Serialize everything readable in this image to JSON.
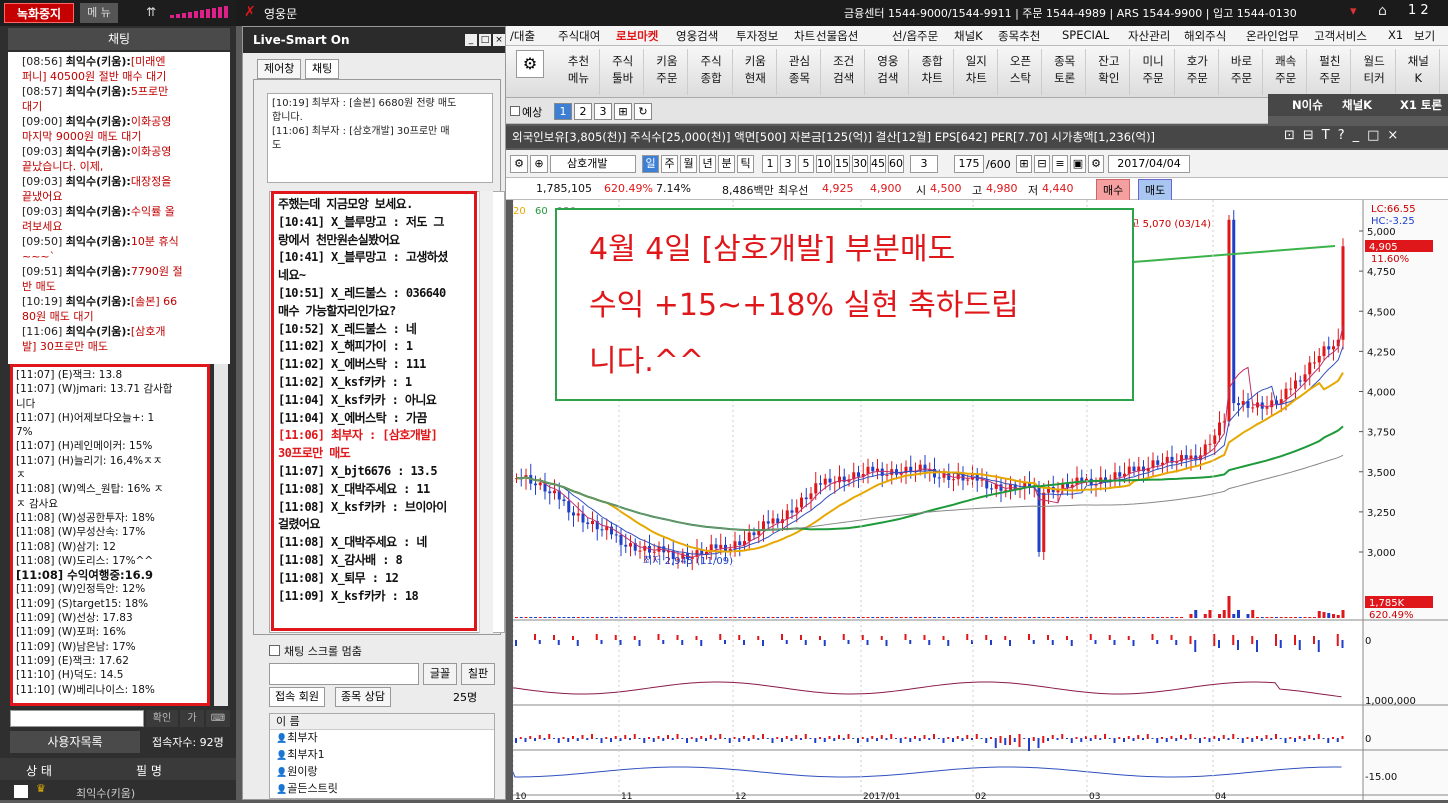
{
  "left": {
    "record_label": "녹화중지",
    "menu_label": "메 뉴",
    "signal_icon": "antenna-icon",
    "chat_title": "채팅",
    "chat1": [
      {
        "t": "[08:56] ",
        "n": "최익수(키움):",
        "m": "[미래엔"
      },
      {
        "t": "",
        "n": "",
        "m": "퍼니] 40500원 절반 매수 대기"
      },
      {
        "t": "[08:57] ",
        "n": "최익수(키움):",
        "m": "5프로만"
      },
      {
        "t": "",
        "n": "",
        "m": "대기"
      },
      {
        "t": "[09:00] ",
        "n": "최익수(키움):",
        "m": "이화공영"
      },
      {
        "t": "",
        "n": "",
        "m": "마지막 9000원 매도 대기"
      },
      {
        "t": "[09:03] ",
        "n": "최익수(키움):",
        "m": "이화공영"
      },
      {
        "t": "",
        "n": "",
        "m": "끝났습니다. 이제,"
      },
      {
        "t": "[09:03] ",
        "n": "최익수(키움):",
        "m": "대장정을"
      },
      {
        "t": "",
        "n": "",
        "m": "끝냈어요"
      },
      {
        "t": "[09:03] ",
        "n": "최익수(키움):",
        "m": "수익률 올"
      },
      {
        "t": "",
        "n": "",
        "m": "려보세요"
      },
      {
        "t": "[09:50] ",
        "n": "최익수(키움):",
        "m": "10분 휴식"
      },
      {
        "t": "",
        "n": "",
        "m": "~~~`"
      },
      {
        "t": "[09:51] ",
        "n": "최익수(키움):",
        "m": "7790원 절"
      },
      {
        "t": "",
        "n": "",
        "m": "반 매도"
      },
      {
        "t": "[10:19] ",
        "n": "최익수(키움):",
        "m": "[솔본] 66"
      },
      {
        "t": "",
        "n": "",
        "m": "80원 매도 대기"
      },
      {
        "t": "[11:06] ",
        "n": "최익수(키움):",
        "m": "[삼호개"
      },
      {
        "t": "",
        "n": "",
        "m": "발] 30프로만 매도"
      }
    ],
    "chat2": [
      "[11:07] (E)잭크: 13.8",
      "[11:07] (W)jmari: 13.71 감사합",
      "니다",
      "[11:07] (H)어제보다오늘+: 1",
      "7%",
      "[11:07] (H)레인메이커: 15%",
      "[11:07] (H)늘리기: 16,4%ㅈㅈ",
      "ㅈ",
      "[11:08] (W)엑스_원탑: 16% ㅈ",
      "ㅈ 감사요",
      "[11:08] (W)성공한투자: 18%",
      "[11:08] (W)무성산속: 17%",
      "[11:08] (W)삼기: 12",
      "[11:08] (W)도리스: 17%^^",
      "[11:08] 수익여행중:16.9",
      "[11:09] (W)인정득안: 12%",
      "[11:09] (S)target15: 18%",
      "[11:09] (W)선상: 17.83",
      "[11:09] (W)포퍼: 16%",
      "[11:09] (W)남은남: 17%",
      "[11:09] (E)잭크: 17.62",
      "[11:10] (H)덕도: 14.5",
      "[11:10] (W)베리나이스: 18%"
    ],
    "confirm_label": "확인",
    "userlist_label": "사용자목록",
    "connections": "접속자수: 92명",
    "col_status": "상 태",
    "col_name": "필 명",
    "last_user": "최익수(키움)"
  },
  "ls": {
    "title": "Live-Smart On",
    "tab_notice": "제어창",
    "tab_chat": "채팅",
    "notice": [
      "[10:19] 최부자 : [솔본] 6680원 전량 매도",
      "합니다.",
      "[11:06] 최부자 : [삼호개발] 30프로만 매",
      "도"
    ],
    "chat": [
      {
        "c": "",
        "m": "주했는데 지금모앙 보세요."
      },
      {
        "c": "",
        "m": "[10:41] X_블루망고 : 저도 그"
      },
      {
        "c": "",
        "m": "랑에서 천만원손실봤어요"
      },
      {
        "c": "",
        "m": "[10:41] X_블루망고 : 고생하셨"
      },
      {
        "c": "",
        "m": "네요~"
      },
      {
        "c": "",
        "m": "[10:51] X_레드불스 : 036640"
      },
      {
        "c": "",
        "m": "매수 가능할자리인가요?"
      },
      {
        "c": "",
        "m": "[10:52] X_레드불스 : 네"
      },
      {
        "c": "",
        "m": "[11:02] X_해피가이 : 1"
      },
      {
        "c": "",
        "m": "[11:02] X_에버스탁 : 111"
      },
      {
        "c": "",
        "m": "[11:02] X_ksf카카 : 1"
      },
      {
        "c": "",
        "m": "[11:04] X_ksf카카 : 아니요"
      },
      {
        "c": "",
        "m": "[11:04] X_에버스탁 : 가끔"
      },
      {
        "c": "red",
        "m": "[11:06] 최부자 : [삼호개발]"
      },
      {
        "c": "red",
        "m": "30프로만 매도"
      },
      {
        "c": "",
        "m": "[11:07] X_bjt6676 : 13.5"
      },
      {
        "c": "",
        "m": "[11:08] X_대박주세요 : 11"
      },
      {
        "c": "",
        "m": "[11:08] X_ksf카카 : 브이아이"
      },
      {
        "c": "",
        "m": "걸렸어요"
      },
      {
        "c": "",
        "m": "[11:08] X_대박주세요 : 네"
      },
      {
        "c": "",
        "m": "[11:08] X_감사배 : 8"
      },
      {
        "c": "",
        "m": "[11:08] X_퇴무 : 12"
      },
      {
        "c": "",
        "m": "[11:09] X_ksf카카 : 18"
      }
    ],
    "stop_scroll": "채팅 스크롤 멈춤",
    "btn_font": "글꼴",
    "btn_board": "칠판",
    "tab_members": "접속 회원",
    "tab_consult": "종목 상담",
    "count": "25명",
    "col_name": "이 름",
    "users": [
      "최부자",
      "최부자1",
      "원이랑",
      "골든스트릿"
    ]
  },
  "app": {
    "title": "영웅문",
    "info": "금융센터 1544-9000/1544-9911 | 주문 1544-4989 | ARS 1544-9900 | 입고 1544-0130",
    "page": "1 2",
    "menu": [
      "/대출",
      "주식대여",
      "로보마켓",
      "영웅검색",
      "투자정보",
      "차트",
      "선물옵션",
      "선/옵주문",
      "채널K",
      "종목추천",
      "SPECIAL",
      "자산관리",
      "해외주식",
      "온라인업무",
      "고객서비스",
      "X1",
      "보기"
    ],
    "toolbar": [
      [
        "추천",
        "메뉴"
      ],
      [
        "주식",
        "툴바"
      ],
      [
        "키움",
        "주문"
      ],
      [
        "주식",
        "종합"
      ],
      [
        "키움",
        "현재"
      ],
      [
        "관심",
        "종목"
      ],
      [
        "조건",
        "검색"
      ],
      [
        "영웅",
        "검색"
      ],
      [
        "종합",
        "차트"
      ],
      [
        "일지",
        "차트"
      ],
      [
        "오픈",
        "스탁"
      ],
      [
        "종목",
        "토론"
      ],
      [
        "잔고",
        "확인"
      ],
      [
        "미니",
        "주문"
      ],
      [
        "호가",
        "주문"
      ],
      [
        "바로",
        "주문"
      ],
      [
        "쾌속",
        "주문"
      ],
      [
        "펄친",
        "주문"
      ],
      [
        "월드",
        "티커"
      ],
      [
        "채널",
        "K"
      ]
    ],
    "pages": [
      "1",
      "2",
      "3"
    ],
    "yesang": "예상",
    "right_tabs": [
      "N이슈",
      "채널K",
      "X1 토론"
    ],
    "infobar": "외국인보유[3,805(천)] 주식수[25,000(천)] 액면[500] 자본금[125(억)] 결산[12월] EPS[642] PER[7.70] 시가총액[1,236(억)]",
    "stock": "삼호개발",
    "periods": [
      "일",
      "주",
      "월",
      "년",
      "분",
      "틱"
    ],
    "mins": [
      "1",
      "3",
      "5",
      "10",
      "15",
      "30",
      "45",
      "60"
    ],
    "cnt": "3",
    "range": "175",
    "total": "/600",
    "date": "2017/04/04",
    "quote": {
      "vol": "1,785,105",
      "pct": "620.49%",
      "chg": "7.14%",
      "amt": "8,486백만",
      "label_price": "최우선",
      "p1": "4,925",
      "p2": "4,900",
      "l_open": "시",
      "open": "4,500",
      "l_high": "고",
      "high": "4,980",
      "l_low": "저",
      "low": "4,440",
      "buy": "매수",
      "sell": "매도"
    }
  },
  "annotation": [
    "4월 4일 [삼호개발] 부분매도",
    "수익 +15~+18% 실현 축하드립",
    "니다.^^"
  ],
  "chart_labels": {
    "high": "최고 5,070 (03/14)",
    "low": "최저 2,945 (11/09)",
    "lc": "LC:66.55",
    "hc": "HC:-3.25",
    "last": "4,905",
    "lastpct": "11.60%",
    "volbox": "1,785K",
    "volpct": "620.49%",
    "ma": [
      "20",
      "60",
      "120"
    ],
    "yticks": [
      "5,000",
      "4,750",
      "4,500",
      "4,250",
      "4,000",
      "3,750",
      "3,500",
      "3,250",
      "3,000"
    ],
    "vticks": [
      "0",
      "1,000,000",
      "0",
      "-15.00"
    ],
    "xticks": [
      "10",
      "11",
      "12",
      "2017/01",
      "02",
      "03",
      "04"
    ]
  }
}
